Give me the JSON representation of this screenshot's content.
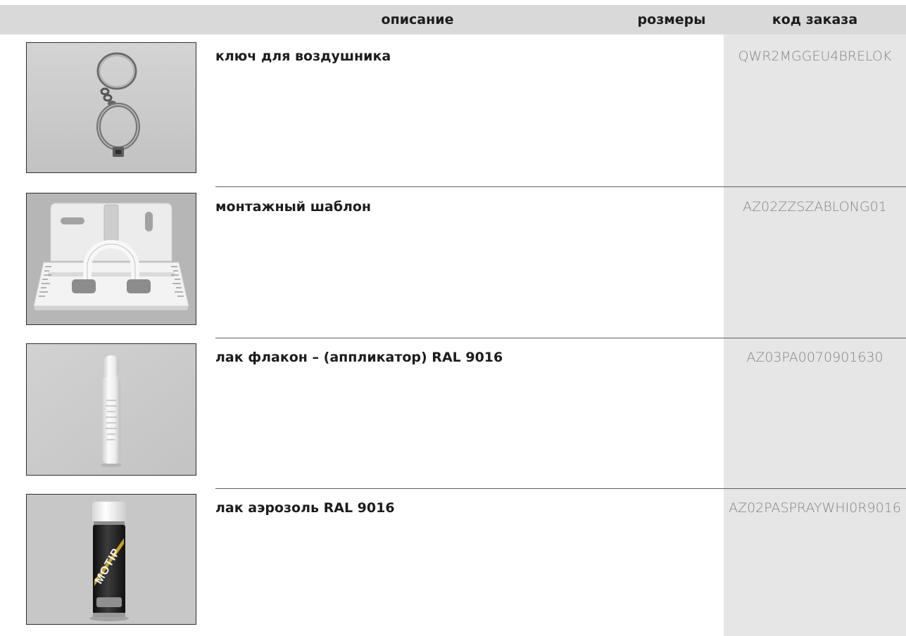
{
  "header": {
    "col_description": "описание",
    "col_sizes": "розмеры",
    "col_order_code": "код заказа"
  },
  "products": [
    {
      "description": "ключ для воздушника",
      "order_code": "QWR2MGGEU4BRELOK"
    },
    {
      "description": "монтажный шаблон",
      "order_code": "AZ02ZZSZABLONG01"
    },
    {
      "description": "лак флакон – (аппликатор) RAL 9016",
      "order_code": "AZ03PA0070901630"
    },
    {
      "description": "лак аэрозоль RAL 9016",
      "order_code": "AZ02PASPRAYWHI0R9016",
      "image_logo": "MOTIP"
    }
  ],
  "colors": {
    "header_bg": "#d9d9d9",
    "code_column_bg": "#e6e6e6",
    "divider": "#5f5f5f",
    "code_text": "#858585",
    "text": "#1c1c1c"
  }
}
